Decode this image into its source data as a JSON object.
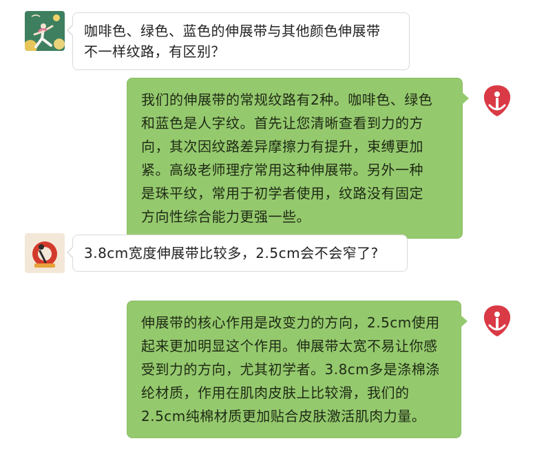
{
  "colors": {
    "outgoing_bubble": "#95c96e",
    "incoming_bubble": "#ffffff",
    "brand_red": "#d93a45"
  },
  "messages": [
    {
      "side": "incoming",
      "avatar": "customer-yoga-avatar-green",
      "lines": [
        "咖啡色、绿色、蓝色的伸展带与其他颜色伸展带",
        "不一样纹路，有区别？"
      ]
    },
    {
      "side": "outgoing",
      "avatar": "brand-logo-red",
      "lines": [
        "我们的伸展带的常规纹路有2种。咖啡色、绿色",
        "和蓝色是人字纹。首先让您清晰查看到力的方",
        "向，其次因纹路差异摩擦力有提升，束缚更加",
        "紧。高级老师理疗常用这种伸展带。另外一种",
        "是珠平纹，常用于初学者使用，纹路没有固定",
        "方向性综合能力更强一些。"
      ]
    },
    {
      "side": "incoming",
      "avatar": "customer-yoga-avatar-red",
      "lines": [
        "3.8cm宽度伸展带比较多，2.5cm会不会窄了?"
      ]
    },
    {
      "side": "outgoing",
      "avatar": "brand-logo-red",
      "lines": [
        "伸展带的核心作用是改变力的方向，2.5cm使用",
        "起来更加明显这个作用。伸展带太宽不易让你感",
        "受到力的方向，尤其初学者。3.8cm多是涤棉涤",
        "纶材质，作用在肌肉皮肤上比较滑，我们的",
        "2.5cm纯棉材质更加贴合皮肤激活肌肉力量。"
      ]
    }
  ]
}
